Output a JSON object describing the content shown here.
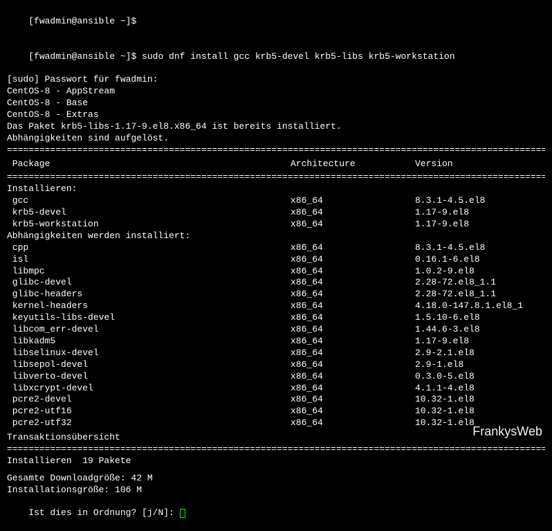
{
  "prompt1": "[fwadmin@ansible ~]$",
  "prompt2": "[fwadmin@ansible ~]$ ",
  "command": "sudo dnf install gcc krb5-devel krb5-libs krb5-workstation",
  "sudo_password": "[sudo] Passwort für fwadmin:",
  "repos": [
    "CentOS-8 - AppStream",
    "CentOS-8 - Base",
    "CentOS-8 - Extras"
  ],
  "already_installed": "Das Paket krb5-libs-1.17-9.el8.x86_64 ist bereits installiert.",
  "deps_resolved": "Abhängigkeiten sind aufgelöst.",
  "headers": {
    "package": " Package",
    "arch": "Architecture",
    "version": "Version"
  },
  "install_section": "Installieren:",
  "install_packages": [
    {
      "name": " gcc",
      "arch": "x86_64",
      "version": "8.3.1-4.5.el8"
    },
    {
      "name": " krb5-devel",
      "arch": "x86_64",
      "version": "1.17-9.el8"
    },
    {
      "name": " krb5-workstation",
      "arch": "x86_64",
      "version": "1.17-9.el8"
    }
  ],
  "deps_section": "Abhängigkeiten werden installiert:",
  "dep_packages": [
    {
      "name": " cpp",
      "arch": "x86_64",
      "version": "8.3.1-4.5.el8"
    },
    {
      "name": " isl",
      "arch": "x86_64",
      "version": "0.16.1-6.el8"
    },
    {
      "name": " libmpc",
      "arch": "x86_64",
      "version": "1.0.2-9.el8"
    },
    {
      "name": " glibc-devel",
      "arch": "x86_64",
      "version": "2.28-72.el8_1.1"
    },
    {
      "name": " glibc-headers",
      "arch": "x86_64",
      "version": "2.28-72.el8_1.1"
    },
    {
      "name": " kernel-headers",
      "arch": "x86_64",
      "version": "4.18.0-147.8.1.el8_1"
    },
    {
      "name": " keyutils-libs-devel",
      "arch": "x86_64",
      "version": "1.5.10-6.el8"
    },
    {
      "name": " libcom_err-devel",
      "arch": "x86_64",
      "version": "1.44.6-3.el8"
    },
    {
      "name": " libkadm5",
      "arch": "x86_64",
      "version": "1.17-9.el8"
    },
    {
      "name": " libselinux-devel",
      "arch": "x86_64",
      "version": "2.9-2.1.el8"
    },
    {
      "name": " libsepol-devel",
      "arch": "x86_64",
      "version": "2.9-1.el8"
    },
    {
      "name": " libverto-devel",
      "arch": "x86_64",
      "version": "0.3.0-5.el8"
    },
    {
      "name": " libxcrypt-devel",
      "arch": "x86_64",
      "version": "4.1.1-4.el8"
    },
    {
      "name": " pcre2-devel",
      "arch": "x86_64",
      "version": "10.32-1.el8"
    },
    {
      "name": " pcre2-utf16",
      "arch": "x86_64",
      "version": "10.32-1.el8"
    },
    {
      "name": " pcre2-utf32",
      "arch": "x86_64",
      "version": "10.32-1.el8"
    }
  ],
  "transaction_summary": "Transaktionsübersicht",
  "install_count": "Installieren  19 Pakete",
  "download_size": "Gesamte Downloadgröße: 42 M",
  "install_size": "Installationsgröße: 106 M",
  "confirm": "Ist dies in Ordnung? [j/N]: ",
  "watermark": "FrankysWeb",
  "divider_char": "================================================================================================================="
}
